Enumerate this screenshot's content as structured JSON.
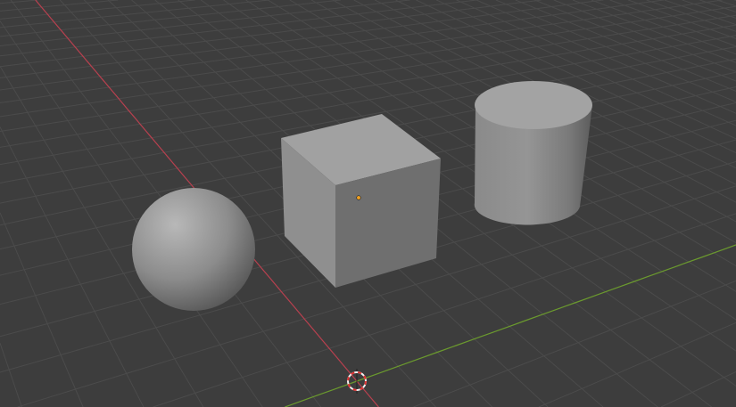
{
  "colors": {
    "background": "#3d3d3d",
    "grid": "#4b4b4b",
    "x_axis": "#b8404f",
    "y_axis": "#6b9a2e",
    "object_origin": "#f0a020",
    "cursor_red": "#e03030",
    "cursor_white": "#f0f0f0"
  },
  "scene": {
    "objects": [
      "sphere",
      "cube",
      "cylinder"
    ]
  }
}
